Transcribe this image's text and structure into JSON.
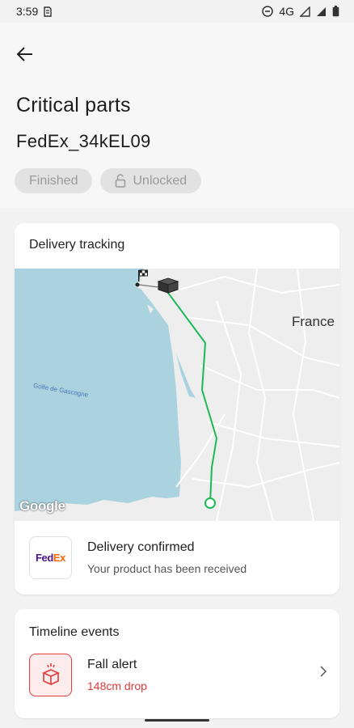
{
  "status_bar": {
    "time": "3:59",
    "network": "4G"
  },
  "header": {
    "title": "Critical parts",
    "shipment_id": "FedEx_34kEL09",
    "chips": [
      {
        "label": "Finished"
      },
      {
        "label": "Unlocked"
      }
    ]
  },
  "tracking": {
    "card_title": "Delivery tracking",
    "map": {
      "country_label": "France",
      "sea_label": "Golfe de Gascogne",
      "attribution": "Google"
    },
    "delivery": {
      "carrier_logo": {
        "part1": "Fed",
        "part2": "Ex"
      },
      "title": "Delivery confirmed",
      "description": "Your product has been received"
    }
  },
  "timeline": {
    "card_title": "Timeline events",
    "events": [
      {
        "title": "Fall alert",
        "detail": "148cm drop"
      }
    ]
  },
  "colors": {
    "accent_green": "#1db954",
    "alert_red": "#e33b3b",
    "sea": "#aad3df"
  }
}
